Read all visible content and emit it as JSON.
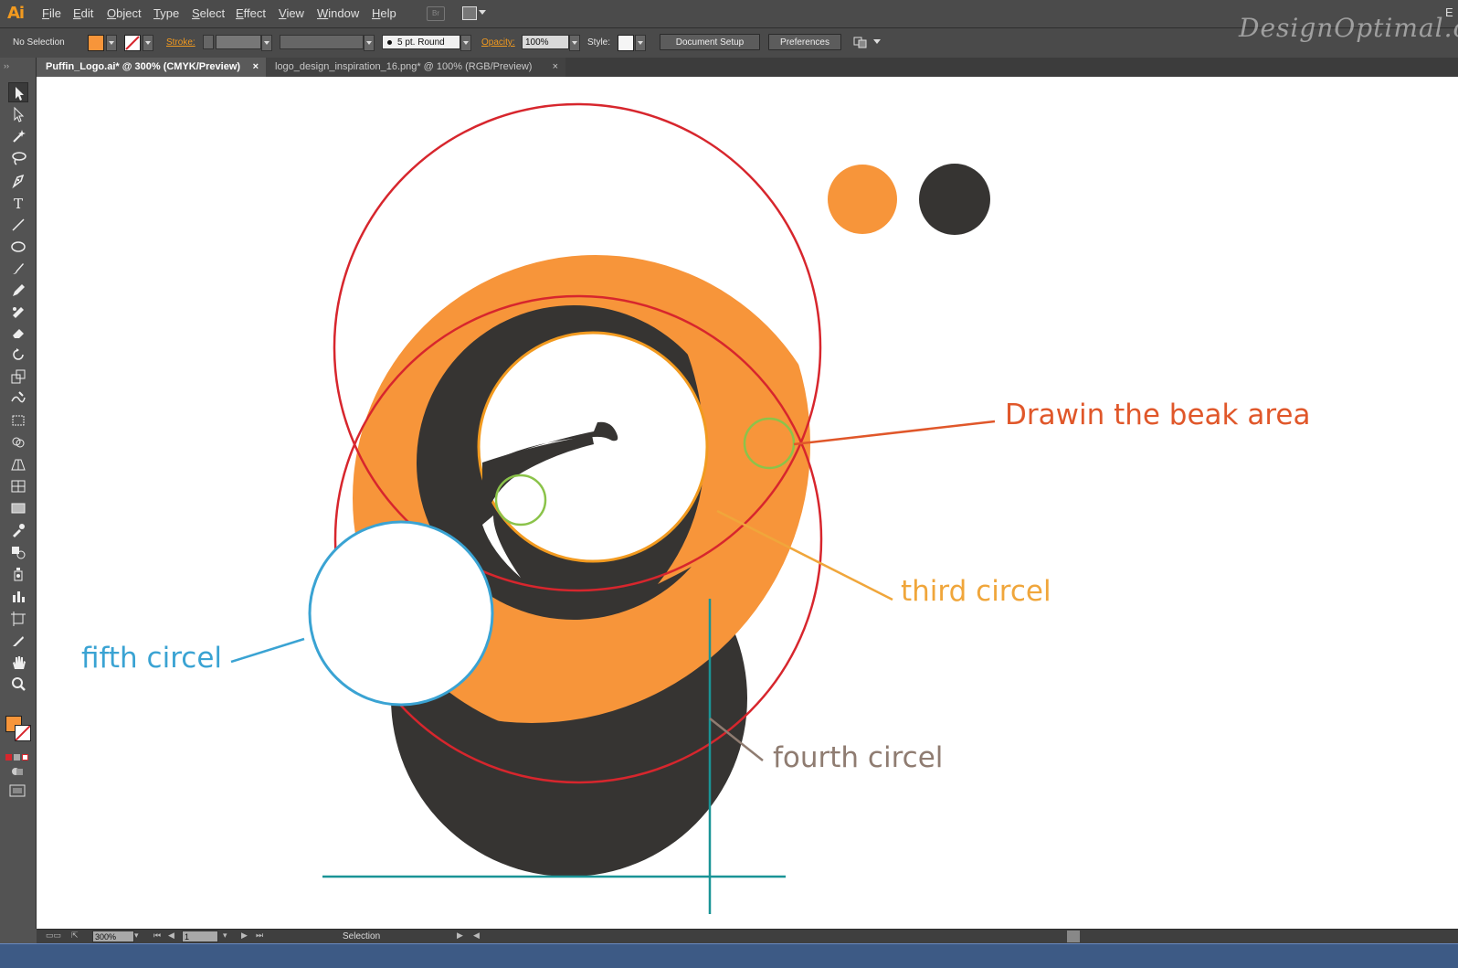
{
  "app": {
    "logo": "Ai"
  },
  "menu": {
    "items": [
      "File",
      "Edit",
      "Object",
      "Type",
      "Select",
      "Effect",
      "View",
      "Window",
      "Help"
    ],
    "bridge": "Br",
    "right_edge": "E"
  },
  "control": {
    "selection_status": "No Selection",
    "fill_color": "#f7953a",
    "stroke_label": "Stroke:",
    "brush_label": "5 pt. Round",
    "opacity_label": "Opacity:",
    "opacity_value": "100%",
    "style_label": "Style:",
    "document_setup": "Document Setup",
    "preferences": "Preferences"
  },
  "watermark": "DesignOptimal.com",
  "tabs": [
    {
      "title": "Puffin_Logo.ai* @ 300% (CMYK/Preview)",
      "close": "×",
      "active": true
    },
    {
      "title": "logo_design_inspiration_16.png* @ 100% (RGB/Preview)",
      "close": "×",
      "active": false
    }
  ],
  "tools": [
    "selection-tool-icon",
    "direct-selection-tool-icon",
    "magic-wand-tool-icon",
    "lasso-tool-icon",
    "pen-tool-icon",
    "type-tool-icon",
    "line-segment-tool-icon",
    "ellipse-tool-icon",
    "paintbrush-tool-icon",
    "pencil-tool-icon",
    "blob-brush-tool-icon",
    "eraser-tool-icon",
    "rotate-tool-icon",
    "scale-tool-icon",
    "warp-tool-icon",
    "free-transform-tool-icon",
    "shape-builder-tool-icon",
    "perspective-grid-tool-icon",
    "mesh-tool-icon",
    "gradient-tool-icon",
    "eyedropper-tool-icon",
    "blend-tool-icon",
    "symbol-sprayer-tool-icon",
    "column-graph-tool-icon",
    "artboard-tool-icon",
    "slice-tool-icon",
    "hand-tool-icon",
    "zoom-tool-icon"
  ],
  "colors": {
    "orange": "#f7953a",
    "dark": "#363432",
    "red": "#d7262d",
    "teal": "#1a9496",
    "blue": "#3aa3d3",
    "green": "#8bc34a"
  },
  "annotations": {
    "beak": "Drawin the beak area",
    "third": "third  circel",
    "fourth": "fourth circel",
    "fifth": "fifth circel"
  },
  "status": {
    "zoom": "300%",
    "artboard": "1",
    "tool": "Selection"
  }
}
